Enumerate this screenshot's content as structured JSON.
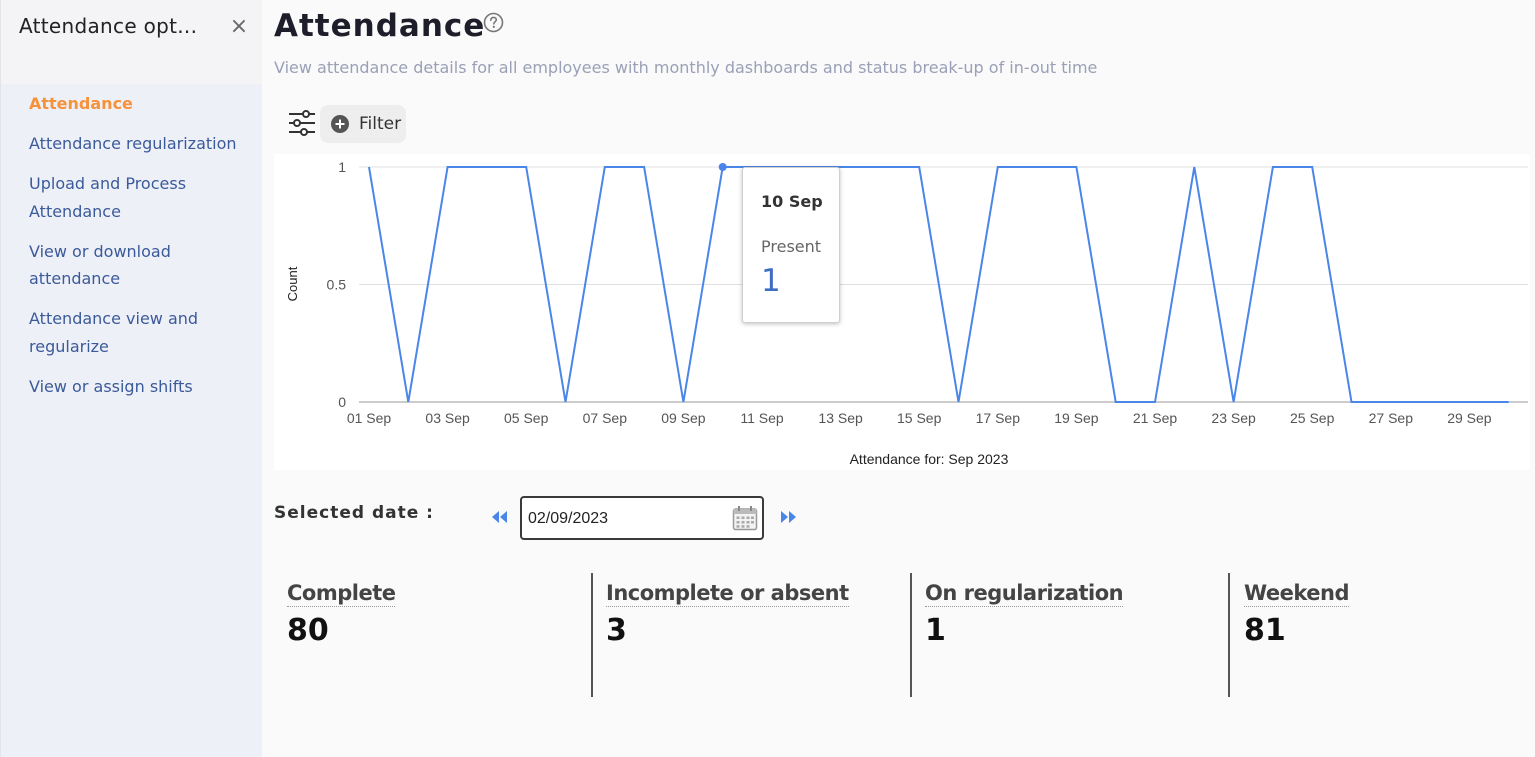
{
  "sidebar": {
    "title": "Attendance opt...",
    "close_glyph": "×",
    "items": [
      {
        "label": "Attendance",
        "active": true
      },
      {
        "label": "Attendance regularization",
        "active": false
      },
      {
        "label": "Upload and Process Attendance",
        "active": false
      },
      {
        "label": "View or download attendance",
        "active": false
      },
      {
        "label": "Attendance view and regularize",
        "active": false
      },
      {
        "label": "View or assign shifts",
        "active": false
      }
    ]
  },
  "header": {
    "title": "Attendance",
    "subtitle": "View attendance details for all employees with monthly dashboards and status break-up of in-out time",
    "help_icon": "question-circle-icon"
  },
  "toolbar": {
    "settings_icon": "sliders-icon",
    "filter_label": "Filter",
    "filter_icon": "plus-circle-icon"
  },
  "chart_data": {
    "type": "line",
    "xlabel": "Attendance for: Sep 2023",
    "ylabel": "Count",
    "ylim": [
      0,
      1
    ],
    "yticks": [
      "0",
      "0.5",
      "1"
    ],
    "xticks": [
      "01 Sep",
      "03 Sep",
      "05 Sep",
      "07 Sep",
      "09 Sep",
      "11 Sep",
      "13 Sep",
      "15 Sep",
      "17 Sep",
      "19 Sep",
      "21 Sep",
      "23 Sep",
      "25 Sep",
      "27 Sep",
      "29 Sep"
    ],
    "grid": true,
    "line_color": "#4a86e8",
    "series": [
      {
        "name": "Present",
        "x": [
          1,
          2,
          3,
          4,
          5,
          6,
          7,
          8,
          9,
          10,
          11,
          12,
          13,
          14,
          15,
          16,
          17,
          18,
          19,
          20,
          21,
          22,
          23,
          24,
          25,
          26,
          27,
          28,
          29,
          30
        ],
        "values": [
          1,
          0,
          1,
          1,
          1,
          0,
          1,
          1,
          0,
          1,
          1,
          1,
          1,
          1,
          1,
          0,
          1,
          1,
          1,
          0,
          0,
          1,
          0,
          1,
          1,
          0,
          0,
          0,
          0,
          0
        ]
      }
    ],
    "tooltip": {
      "date": "10 Sep",
      "series": "Present",
      "value": "1"
    }
  },
  "date_picker": {
    "label": "Selected date :",
    "value": "02/09/2023",
    "prev_icon": "double-chevron-left-icon",
    "next_icon": "double-chevron-right-icon",
    "calendar_icon": "calendar-icon"
  },
  "stats": [
    {
      "label": "Complete",
      "value": "80"
    },
    {
      "label": "Incomplete or absent",
      "value": "3"
    },
    {
      "label": "On regularization",
      "value": "1"
    },
    {
      "label": "Weekend",
      "value": "81"
    }
  ],
  "colors": {
    "accent": "#f5923a",
    "link": "#3b5a9a",
    "chart_line": "#4a86e8"
  }
}
